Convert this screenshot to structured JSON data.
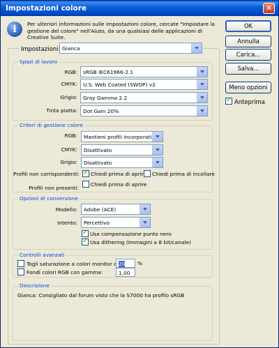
{
  "window": {
    "title": "Impostazioni colore"
  },
  "info": {
    "text": "Per ulteriori informazioni sulle impostazioni colore, cercate \"Impostare la gestione del colore\" nell'Aiuto, da una qualsiasi delle applicazioni di Creative Suite."
  },
  "buttons": {
    "ok": "OK",
    "cancel": "Annulla",
    "load": "Carica...",
    "save": "Salva...",
    "fewer_options": "Meno opzioni"
  },
  "preview": {
    "label": "Anteprima",
    "checked": true
  },
  "settings": {
    "label": "Impostazioni:",
    "value": "Gianca"
  },
  "workspaces": {
    "title": "Spazi di lavoro",
    "rgb": {
      "label": "RGB:",
      "value": "sRGB IEC61966-2.1"
    },
    "cmyk": {
      "label": "CMYK:",
      "value": "U.S. Web Coated (SWOP) v2"
    },
    "gray": {
      "label": "Grigio:",
      "value": "Gray Gamma 2.2"
    },
    "spot": {
      "label": "Tinta piatta:",
      "value": "Dot Gain 20%"
    }
  },
  "policies": {
    "title": "Criteri di gestione colore",
    "rgb": {
      "label": "RGB:",
      "value": "Mantieni profili incorporati"
    },
    "cmyk": {
      "label": "CMYK:",
      "value": "Disattivato"
    },
    "gray": {
      "label": "Grigio:",
      "value": "Disattivato"
    },
    "mismatch_label": "Profili non corrispondenti:",
    "ask_open": "Chiedi prima di aprire",
    "ask_paste": "Chiedi prima di incollare",
    "missing_label": "Profili non presenti:",
    "missing_ask_open": "Chiedi prima di aprire"
  },
  "conversion": {
    "title": "Opzioni di conversione",
    "engine": {
      "label": "Modello:",
      "value": "Adobe (ACE)"
    },
    "intent": {
      "label": "Intento:",
      "value": "Percettivo"
    },
    "bpc": "Usa compensazione punto nero",
    "dither": "Usa dithering (immagini a 8 bit/canale)"
  },
  "advanced": {
    "title": "Controlli avanzati",
    "desaturate": {
      "label": "Togli saturazione a colori monitor di:",
      "value": "20",
      "unit": "%"
    },
    "blend": {
      "label": "Fondi colori RGB con gamma:",
      "value": "1,00"
    }
  },
  "description": {
    "title": "Descrizione",
    "text": "Gianca:  Consigliato dal forum visto che la S7000 ha profilo sRGB"
  },
  "colors": {
    "titlebar": "#0a5fd8",
    "group_title": "#0046d5",
    "dialog_bg": "#ece9d8"
  }
}
